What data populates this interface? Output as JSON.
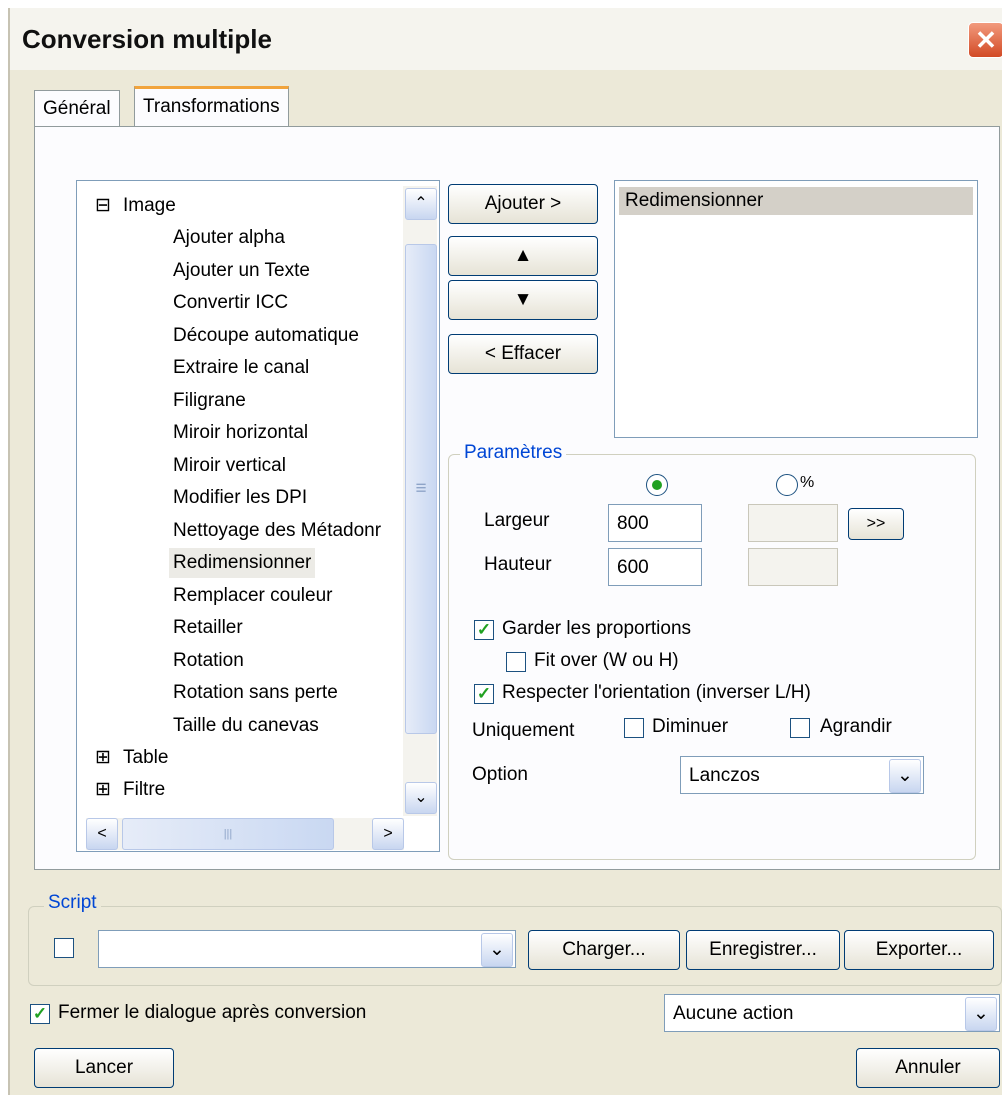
{
  "window": {
    "title": "Conversion multiple",
    "close_glyph": "✕"
  },
  "tabs": [
    {
      "label": "Général"
    },
    {
      "label": "Transformations"
    }
  ],
  "tree": {
    "root_label": "Image",
    "expand_glyph": "⊟",
    "collapsed_glyph": "⊞",
    "items": [
      "Ajouter alpha",
      "Ajouter un Texte",
      "Convertir ICC",
      "Découpe automatique",
      "Extraire le canal",
      "Filigrane",
      "Miroir horizontal",
      "Miroir vertical",
      "Modifier les DPI",
      "Nettoyage des Métadonr",
      "Redimensionner",
      "Remplacer couleur",
      "Retailler",
      "Rotation",
      "Rotation sans perte",
      "Taille du canevas"
    ],
    "selected_item": "Redimensionner",
    "other_roots": [
      "Table",
      "Filtre"
    ]
  },
  "actions": {
    "add": "Ajouter >",
    "up": "▲",
    "down": "▼",
    "remove": "< Effacer"
  },
  "selected_list": [
    "Redimensionner"
  ],
  "params": {
    "group_label": "Paramètres",
    "percent_label": "%",
    "width_label": "Largeur",
    "width_value": "800",
    "height_label": "Hauteur",
    "height_value": "600",
    "copy_button": ">>",
    "keep_proportions": "Garder les proportions",
    "fit_over": "Fit over (W ou H)",
    "respect_orientation": "Respecter l'orientation (inverser L/H)",
    "only_label": "Uniquement",
    "decrease": "Diminuer",
    "enlarge": "Agrandir",
    "option_label": "Option",
    "option_value": "Lanczos"
  },
  "script": {
    "group_label": "Script",
    "load": "Charger...",
    "save": "Enregistrer...",
    "export": "Exporter..."
  },
  "footer": {
    "close_after": "Fermer le dialogue après conversion",
    "action_value": "Aucune action",
    "run": "Lancer",
    "cancel": "Annuler"
  },
  "glyphs": {
    "check": "✓",
    "up_arrow": "⌃",
    "down_arrow": "⌄",
    "left_arrow": "<",
    "right_arrow": ">",
    "grip": "≡",
    "hgrip": "|||",
    "dropdown": "⌄"
  },
  "colors": {
    "accent": "#f1a43c",
    "group_label": "#0046d5",
    "check": "#21a121",
    "window_bg": "#ece9d8"
  }
}
